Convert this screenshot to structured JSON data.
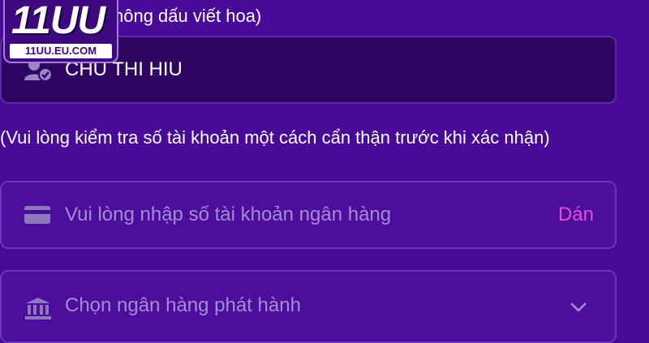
{
  "brand": {
    "logo_text": "11UU",
    "logo_url": "11UU.EU.COM"
  },
  "name_section": {
    "hint": "hông dấu viết hoa)",
    "field_value": "CHU THI HIU",
    "icon": "user-check-icon"
  },
  "account_section": {
    "hint": "(Vui lòng kiểm tra số tài khoản một cách cẩn thận trước khi xác nhận)",
    "placeholder": "Vui lòng nhập số tài khoản ngân hàng",
    "paste_label": "Dán",
    "icon": "card-icon"
  },
  "bank_section": {
    "placeholder": "Chọn ngân hàng phát hành",
    "icon": "bank-icon",
    "dropdown_icon": "chevron-down-icon"
  },
  "colors": {
    "background": "#4a0a99",
    "name_field_bg": "#2e0662",
    "paste_accent": "#e84ad6",
    "placeholder_text": "#a58bd4"
  }
}
